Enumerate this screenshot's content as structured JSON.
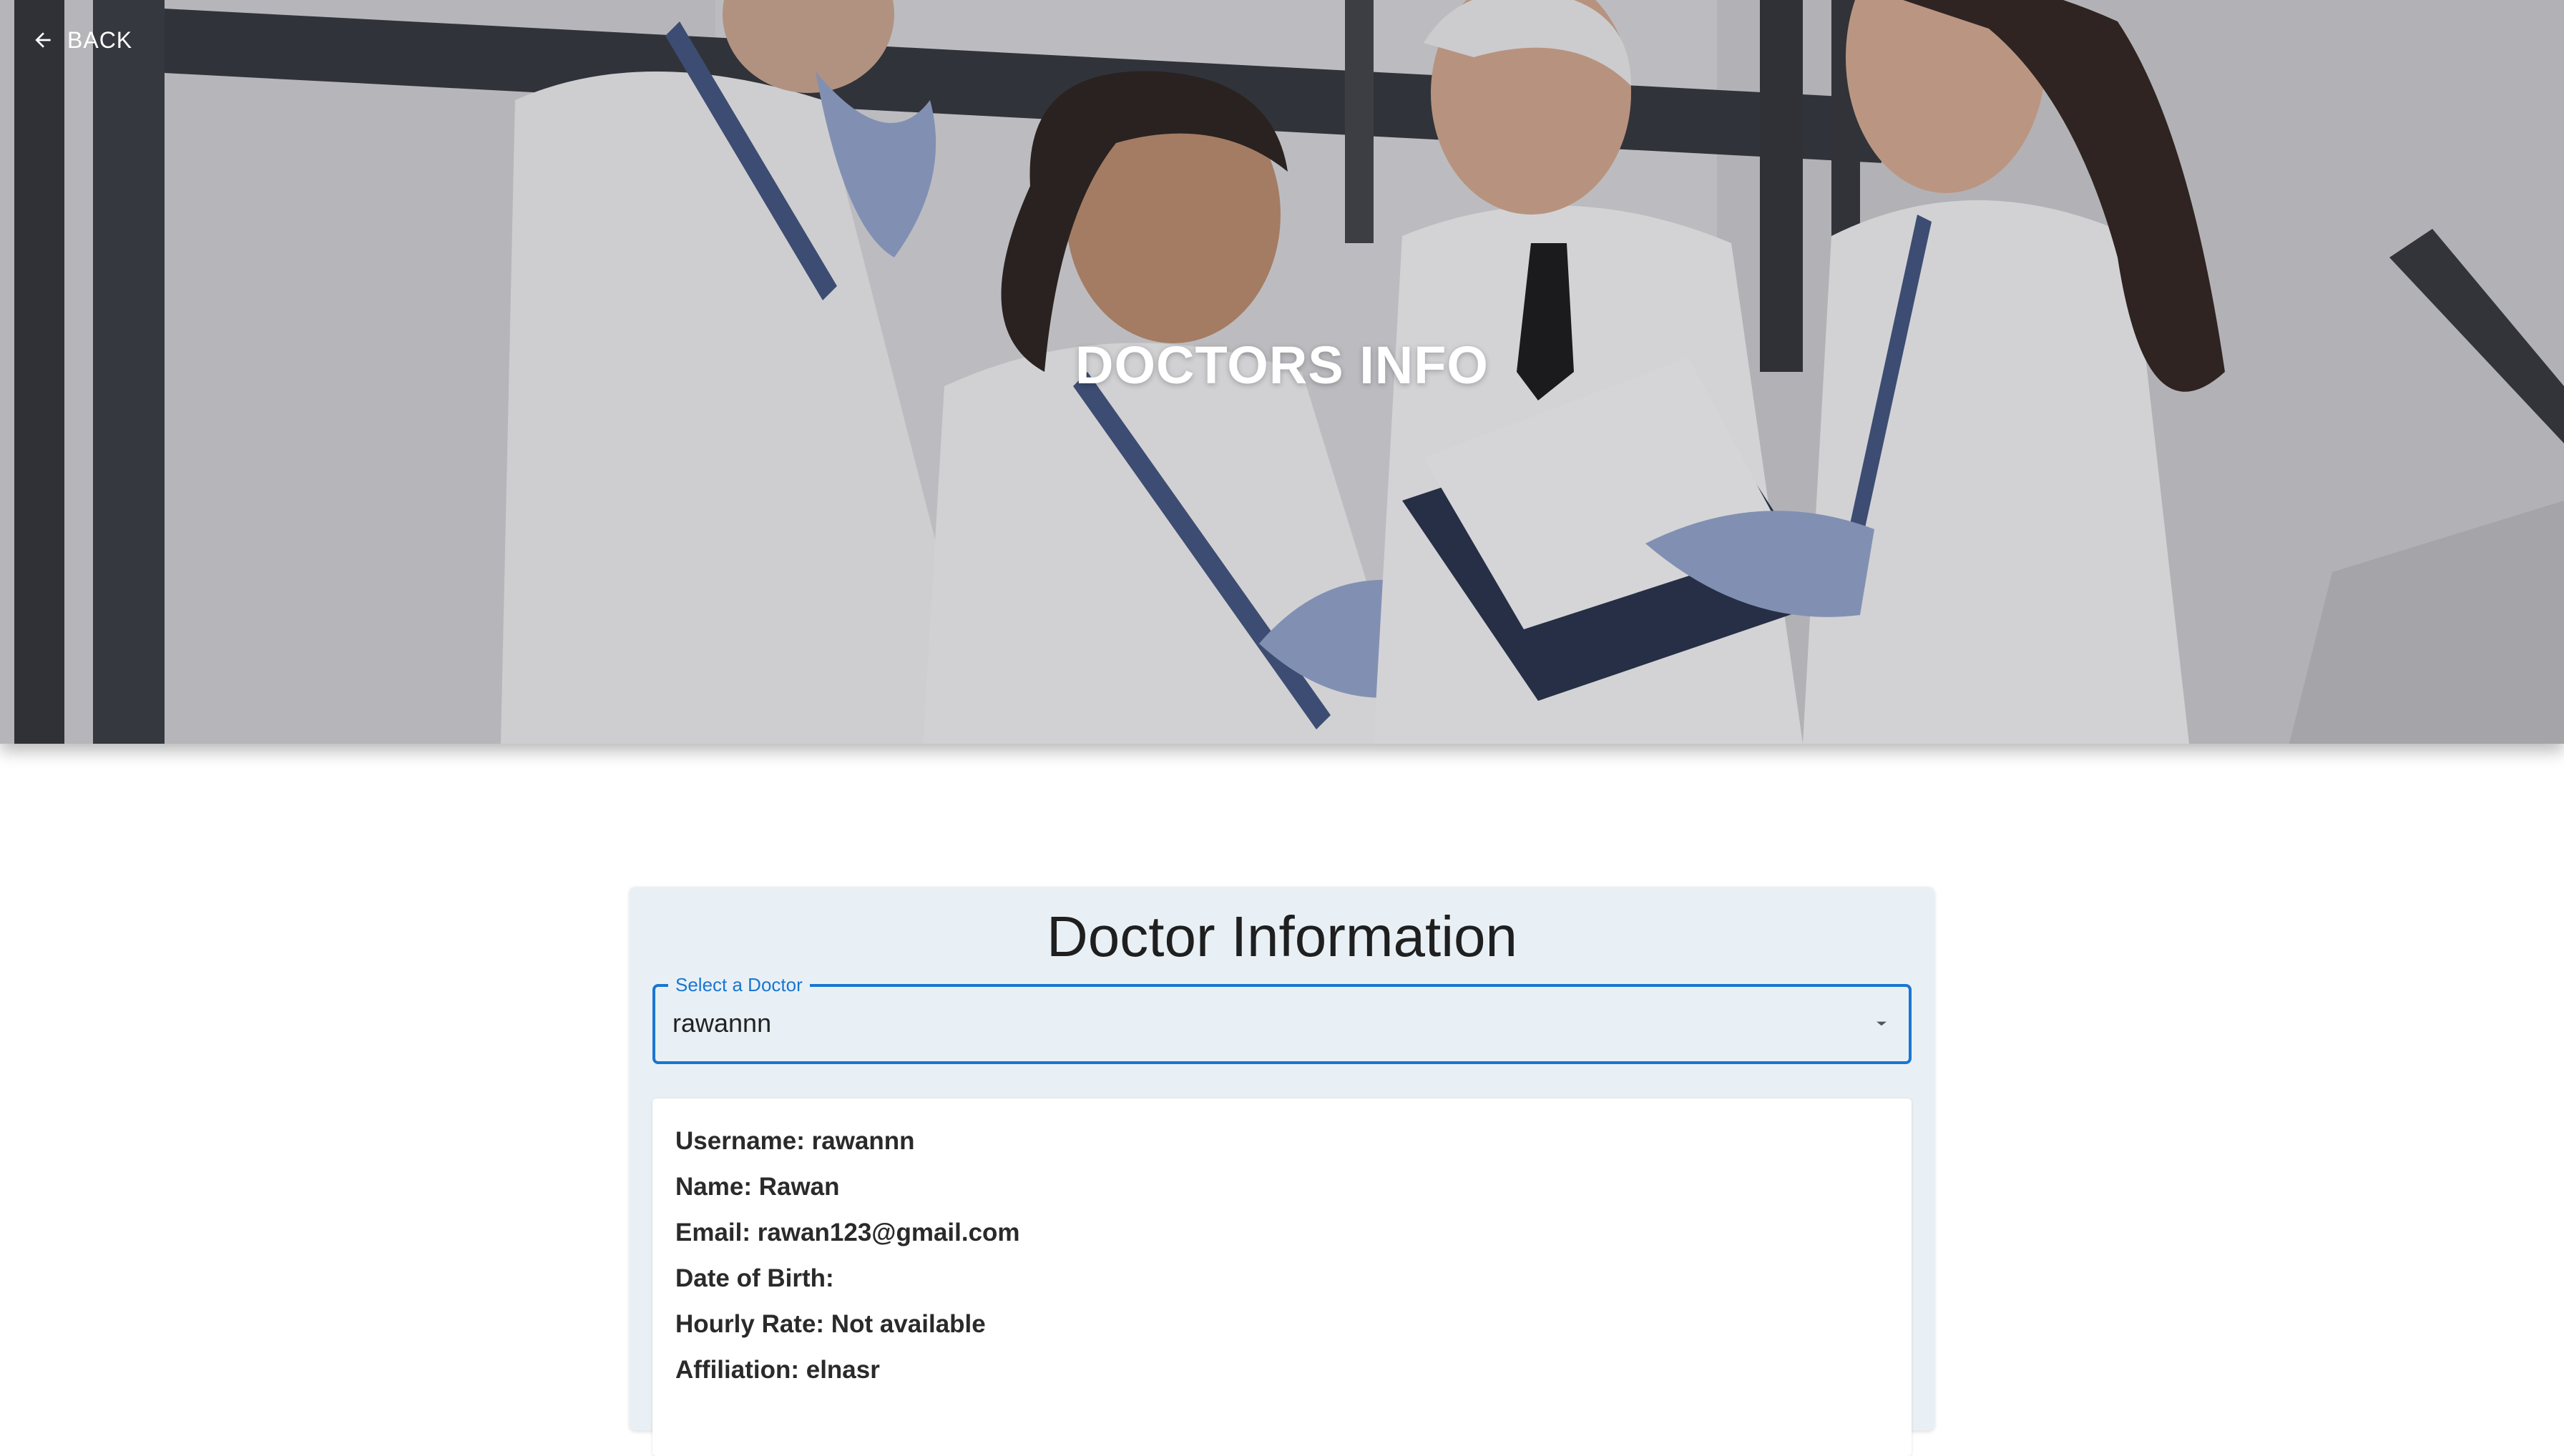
{
  "nav": {
    "back_label": "BACK",
    "back_icon": "arrow-left-icon"
  },
  "hero": {
    "title": "DOCTORS INFO",
    "image": "doctors-team-photo"
  },
  "card": {
    "title": "Doctor Information",
    "select": {
      "label": "Select a Doctor",
      "value": "rawannn",
      "caret_icon": "caret-down-icon",
      "accent_color": "#1976d2"
    },
    "details": [
      "Username: rawannn",
      "Name: Rawan",
      "Email: rawan123@gmail.com",
      "Date of Birth:",
      "Hourly Rate: Not available",
      "Affiliation: elnasr"
    ]
  }
}
